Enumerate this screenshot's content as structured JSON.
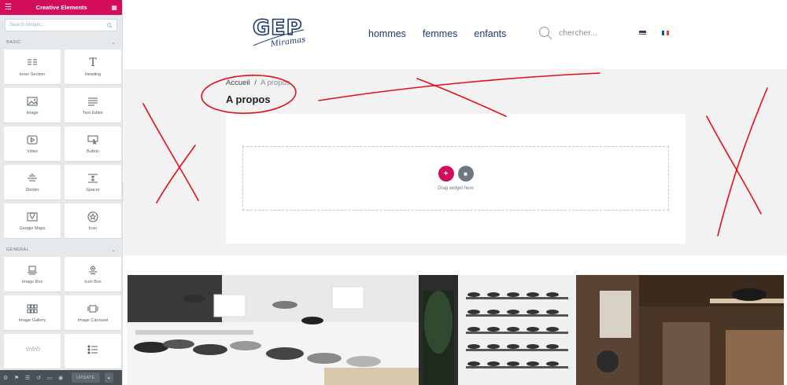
{
  "sidebar": {
    "title": "Creative Elements",
    "menu_icon": "hamburger-icon",
    "grid_icon": "apps-grid-icon",
    "search_placeholder": "Search Widget...",
    "categories": [
      {
        "label": "BASIC",
        "widgets": [
          {
            "label": "Inner Section",
            "icon": "columns-icon"
          },
          {
            "label": "Heading",
            "icon": "heading-icon"
          },
          {
            "label": "Image",
            "icon": "image-icon"
          },
          {
            "label": "Text Editor",
            "icon": "text-editor-icon"
          },
          {
            "label": "Video",
            "icon": "video-icon"
          },
          {
            "label": "Button",
            "icon": "button-icon"
          },
          {
            "label": "Divider",
            "icon": "divider-icon"
          },
          {
            "label": "Spacer",
            "icon": "spacer-icon"
          },
          {
            "label": "Google Maps",
            "icon": "map-icon"
          },
          {
            "label": "Icon",
            "icon": "star-icon"
          }
        ]
      },
      {
        "label": "GENERAL",
        "widgets": [
          {
            "label": "Image Box",
            "icon": "image-box-icon"
          },
          {
            "label": "Icon Box",
            "icon": "icon-box-icon"
          },
          {
            "label": "Image Gallery",
            "icon": "gallery-icon"
          },
          {
            "label": "Image Carousel",
            "icon": "carousel-icon"
          },
          {
            "label": "",
            "icon": "star-rating-icon"
          },
          {
            "label": "",
            "icon": "icon-list-icon"
          }
        ]
      }
    ],
    "footer": {
      "update_label": "UPDATE"
    }
  },
  "site": {
    "logo_text": "GEP",
    "logo_subtext": "Miramas",
    "nav": [
      "hommes",
      "femmes",
      "enfants"
    ],
    "search_placeholder": "chercher...",
    "languages": [
      "English",
      "Français"
    ]
  },
  "page": {
    "breadcrumb_home": "Accueil",
    "breadcrumb_sep": "/",
    "breadcrumb_current": "A propos",
    "title": "A propos",
    "drop_hint": "Drag widget here"
  },
  "colors": {
    "brand": "#d30c5c",
    "navy": "#1e3a6e",
    "annotation": "#e3101a"
  }
}
